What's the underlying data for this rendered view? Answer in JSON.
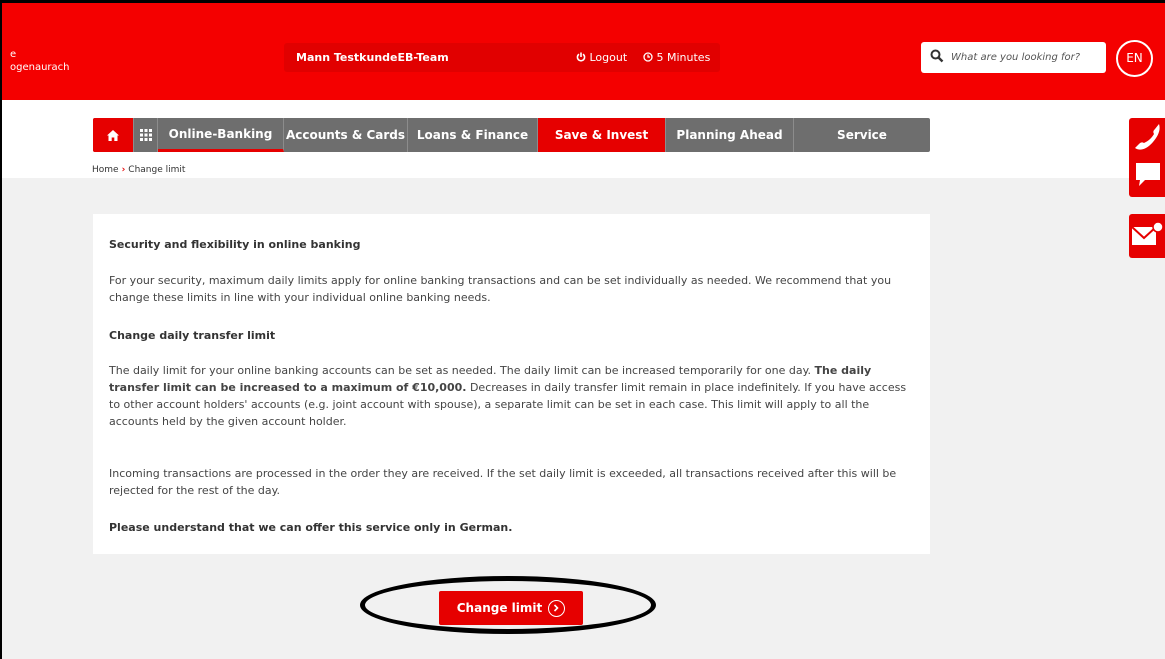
{
  "header": {
    "brand_line1": "e",
    "brand_line2": "ogenaurach",
    "user_name": "Mann TestkundeEB-Team",
    "logout_label": "Logout",
    "timer_label": "5 Minutes",
    "search_placeholder": "What are you looking for?",
    "language": "EN"
  },
  "nav": {
    "items": [
      {
        "label": "Online-Banking"
      },
      {
        "label": "Accounts & Cards"
      },
      {
        "label": "Loans & Finance"
      },
      {
        "label": "Save & Invest"
      },
      {
        "label": "Planning Ahead"
      },
      {
        "label": "Service"
      }
    ]
  },
  "breadcrumb": {
    "home": "Home",
    "current": "Change limit"
  },
  "content": {
    "heading1": "Security and flexibility in online banking",
    "para1": "For your security, maximum daily limits apply for online banking transactions and can be set individually as needed. We recommend that you change these limits in line with your individual online banking needs.",
    "heading2": "Change daily transfer limit",
    "para2_a": "The daily limit for your online banking accounts can be set as needed. The daily limit can be increased temporarily for one day. ",
    "para2_bold": "The daily transfer limit can be increased to a maximum of €10,000.",
    "para2_b": " Decreases in daily transfer limit remain in place indefinitely. If you have access to other account holders' accounts (e.g. joint account with spouse), a separate limit can be set in each case. This limit will apply to all the accounts held by the given account holder.",
    "para3": "Incoming transactions are processed in the order they are received. If the set daily limit is exceeded, all transactions received after this will be rejected for the rest of the day.",
    "para4": "Please understand that we can offer this service only in German."
  },
  "action": {
    "change_limit_label": "Change limit"
  },
  "colors": {
    "brand_red": "#f40000",
    "nav_gray": "#6e6e6e",
    "content_bg": "#f1f1f1"
  },
  "icons": [
    "home-icon",
    "grid-icon",
    "search-icon",
    "power-icon",
    "clock-icon",
    "chevron-right-icon",
    "phone-icon",
    "chat-icon",
    "mail-icon"
  ]
}
